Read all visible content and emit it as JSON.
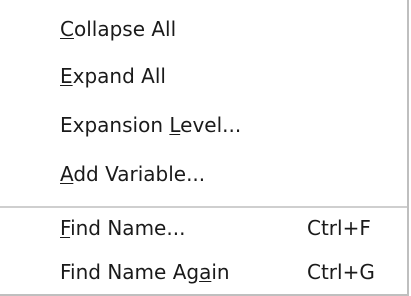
{
  "menu": {
    "items": [
      {
        "pre": "",
        "mnemonic": "C",
        "post": "ollapse All",
        "shortcut": ""
      },
      {
        "pre": "",
        "mnemonic": "E",
        "post": "xpand All",
        "shortcut": ""
      },
      {
        "pre": "Expansion ",
        "mnemonic": "L",
        "post": "evel...",
        "shortcut": ""
      },
      {
        "pre": "",
        "mnemonic": "A",
        "post": "dd Variable...",
        "shortcut": ""
      },
      {
        "pre": "",
        "mnemonic": "F",
        "post": "ind Name...",
        "shortcut": "Ctrl+F"
      },
      {
        "pre": "Find Name Ag",
        "mnemonic": "a",
        "post": "in",
        "shortcut": "Ctrl+G"
      }
    ]
  }
}
